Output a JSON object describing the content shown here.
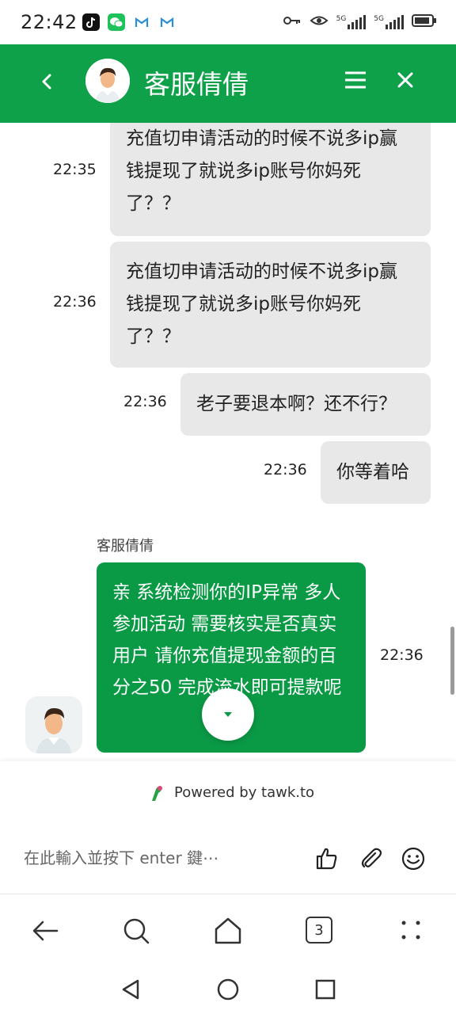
{
  "status_bar": {
    "time": "22:42",
    "signal_1": "5G",
    "signal_2": "5G"
  },
  "header": {
    "title": "客服倩倩",
    "back_icon": "chevron-left-icon",
    "menu_icon": "hamburger-icon",
    "close_icon": "close-icon"
  },
  "messages": [
    {
      "time": "22:35",
      "text": "充值切申请活动的时候不说多ip赢钱提现了就说多ip账号你妈死了？？"
    },
    {
      "time": "22:36",
      "text": "充值切申请活动的时候不说多ip赢钱提现了就说多ip账号你妈死了？？"
    },
    {
      "time": "22:36",
      "text": "老子要退本啊？还不行？"
    },
    {
      "time": "22:36",
      "text": "你等着哈"
    }
  ],
  "agent_message": {
    "name": "客服倩倩",
    "time": "22:36",
    "text": "亲 系统检测你的IP异常 多人参加活动 需要核实是否真实用户 请你充值提现金额的百分之50 完成流水即可提款呢"
  },
  "footer": {
    "powered_by": "Powered by tawk.to",
    "input_placeholder": "在此輸入並按下 enter 鍵⋯"
  },
  "browser_bar": {
    "tab_count": "3"
  },
  "colors": {
    "brand_green": "#0ea14a",
    "agent_bubble": "#0a9a46",
    "user_bubble": "#e8e8e8"
  }
}
